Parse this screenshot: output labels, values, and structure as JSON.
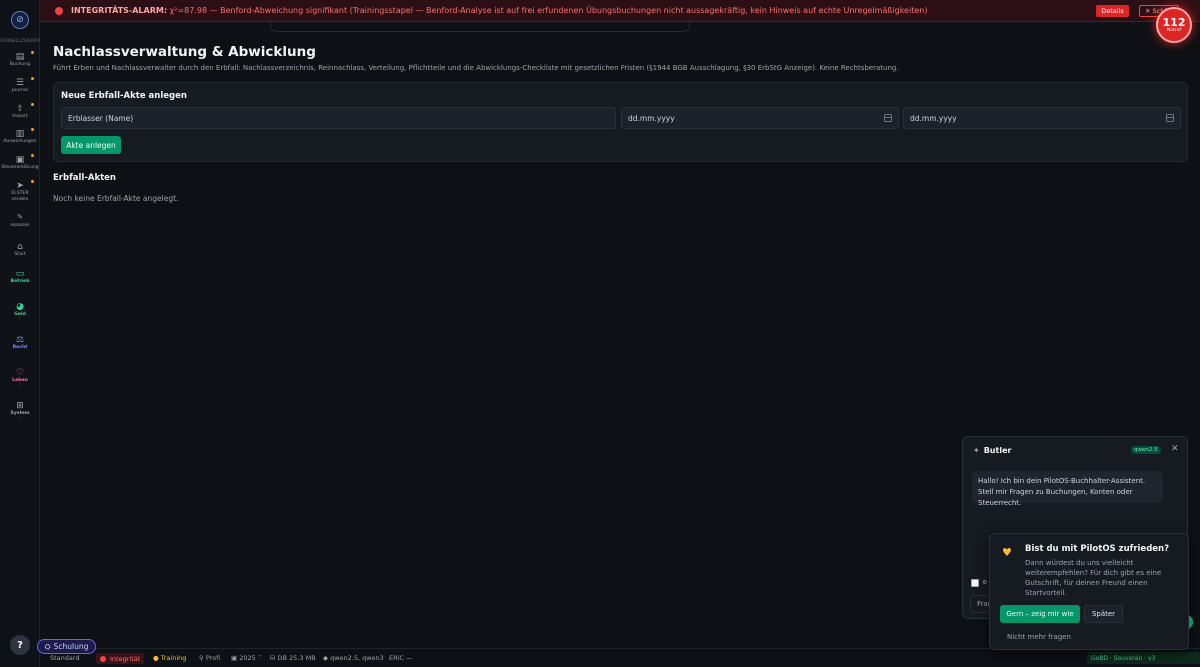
{
  "alarm": {
    "title": "INTEGRITÄTS-ALARM:",
    "text": "χ²=87.98 — Benford-Abweichung signifikant (Trainingsstapel — Benford-Analyse ist auf frei erfundenen Übungsbuchungen nicht aussagekräftig, kein Hinweis auf echte Unregelmäßigkeiten)",
    "details_label": "Details",
    "close_label": "✕ Schließen"
  },
  "notruf": {
    "number": "112",
    "label": "Notruf"
  },
  "sidebar": {
    "header": "SCHNELLZUGRIFF",
    "items": [
      {
        "label": "Buchung",
        "icon": "document-icon"
      },
      {
        "label": "Journal",
        "icon": "list-icon"
      },
      {
        "label": "Import",
        "icon": "upload-icon"
      },
      {
        "label": "Auswertungen",
        "icon": "chart-icon"
      },
      {
        "label": "Steuererklärung",
        "icon": "form-icon"
      },
      {
        "label": "ELSTER senden",
        "icon": "send-icon"
      },
      {
        "label": "anpassen",
        "icon": "pencil-icon"
      }
    ],
    "sections": [
      {
        "label": "Start",
        "color": "#9ca3af"
      },
      {
        "label": "Betrieb",
        "color": "#34d399"
      },
      {
        "label": "Geld",
        "color": "#34d399"
      },
      {
        "label": "Recht",
        "color": "#818cf8"
      },
      {
        "label": "Leben",
        "color": "#f472b6"
      },
      {
        "label": "System",
        "color": "#9ca3af"
      }
    ]
  },
  "page": {
    "title": "Nachlassverwaltung & Abwicklung",
    "description": "Führt Erben und Nachlassverwalter durch den Erbfall: Nachlassverzeichnis, Reinnachlass, Verteilung, Pflichtteile und die Abwicklungs-Checkliste mit gesetzlichen Fristen (§1944 BGB Ausschlagung, §30 ErbStG Anzeige). Keine Rechtsberatung."
  },
  "form": {
    "title": "Neue Erbfall-Akte anlegen",
    "name_placeholder": "Erblasser (Name)",
    "date1_placeholder": "dd.mm.yyyy",
    "date2_placeholder": "dd.mm.yyyy",
    "submit_label": "Akte anlegen"
  },
  "list": {
    "title": "Erbfall-Akten",
    "empty": "Noch keine Erbfall-Akte angelegt."
  },
  "help_label": "?",
  "schulung_label": "Schulung",
  "status": {
    "mode": "Standard",
    "integritaet": "Integrität",
    "training": "Training",
    "profil": "Profi",
    "year": "2025",
    "db": "DB 25.3 MB",
    "models": "qwen2.5, qwen3",
    "eric": "ERiC —",
    "version": "GoBD · Souverän · v3"
  },
  "butler": {
    "title": "Butler",
    "model": "qwen2.5",
    "greeting": "Hallo! Ich bin dein PilotOS-Buchhalter-Assistent. Stell mir Fragen zu Buchungen, Konten oder Steuerrecht.",
    "input_placeholder": "Frag"
  },
  "survey": {
    "title": "Bist du mit PilotOS zufrieden?",
    "body": "Dann würdest du uns vielleicht weiterempfehlen? Für dich gibt es eine Gutschrift, für deinen Freund einen Startvorteil.",
    "yes_label": "Gern – zeig mir wie",
    "later_label": "Später",
    "never_label": "Nicht mehr fragen"
  }
}
